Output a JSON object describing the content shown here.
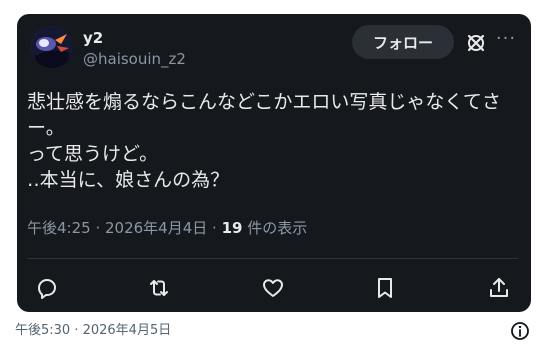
{
  "author": {
    "display_name": "y2",
    "handle": "@haisouin_z2"
  },
  "follow_label": "フォロー",
  "tweet": {
    "text": "悲壮感を煽るならこんなどこかエロい写真じゃなくてさー。\nって思うけど。\n‥本当に、娘さんの為？",
    "timestamp": "午後4:25 · 2026年4月4日 · ",
    "views_count": "19",
    "views_suffix": " 件の表示"
  },
  "actions": [
    "reply-icon",
    "retweet-icon",
    "like-icon",
    "bookmark-icon",
    "share-icon"
  ],
  "footer": {
    "timestamp": "午後5:30 · 2026年4月5日"
  },
  "colors": {
    "card_bg": "#15181c",
    "text": "#e7e9ea",
    "muted": "#8b98a5",
    "follow_bg": "#2b3036"
  }
}
